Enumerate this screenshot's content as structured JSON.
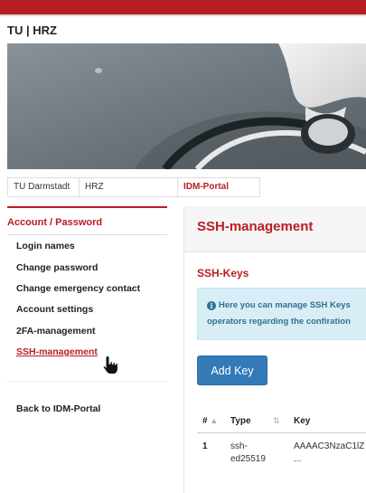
{
  "header": {
    "brand": "TU | HRZ"
  },
  "breadcrumb": [
    "TU Darmstadt",
    "HRZ",
    "IDM-Portal"
  ],
  "sidebar": {
    "heading": "Account / Password",
    "items": [
      {
        "label": "Login names"
      },
      {
        "label": "Change password"
      },
      {
        "label": "Change emergency contact"
      },
      {
        "label": "Account settings"
      },
      {
        "label": "2FA-management"
      },
      {
        "label": "SSH-management"
      }
    ],
    "back_label": "Back to IDM-Portal"
  },
  "main": {
    "title": "SSH-management",
    "subtitle": "SSH-Keys",
    "alert_line1": "Here you can manage SSH Keys",
    "alert_line2": "operators regarding the confiration",
    "add_key_label": "Add Key",
    "table": {
      "headers": [
        "#",
        "Type",
        "Key"
      ],
      "rows": [
        {
          "num": "1",
          "type_1": "ssh-",
          "type_2": "ed25519",
          "key_1": "AAAAC3NzaC1lZ",
          "key_2": "..."
        }
      ]
    }
  },
  "colors": {
    "accent": "#b71e24",
    "button": "#337ab7",
    "alert_bg": "#d9edf7",
    "alert_text": "#31708f"
  },
  "icons": [
    "info-icon",
    "sort-asc-icon",
    "sort-icon",
    "hand-pointer-cursor"
  ]
}
